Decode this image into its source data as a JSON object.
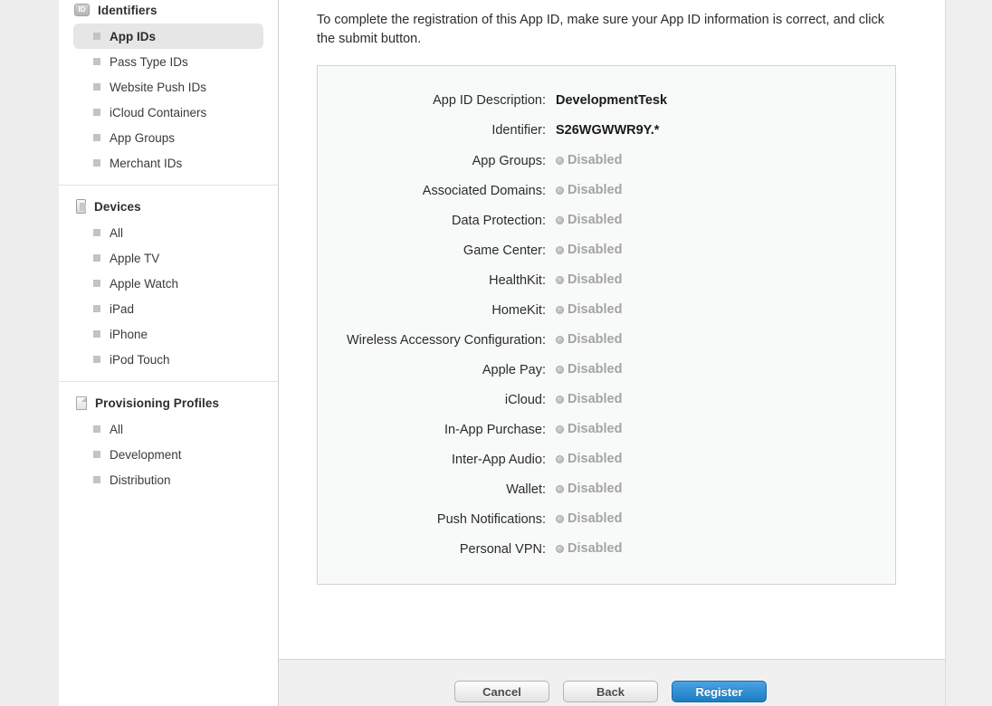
{
  "sidebar": {
    "sections": [
      {
        "title": "Identifiers",
        "icon": "id-badge-icon",
        "icon_text": "ID",
        "items": [
          {
            "label": "App IDs",
            "selected": true
          },
          {
            "label": "Pass Type IDs",
            "selected": false
          },
          {
            "label": "Website Push IDs",
            "selected": false
          },
          {
            "label": "iCloud Containers",
            "selected": false
          },
          {
            "label": "App Groups",
            "selected": false
          },
          {
            "label": "Merchant IDs",
            "selected": false
          }
        ]
      },
      {
        "title": "Devices",
        "icon": "device-phone-icon",
        "items": [
          {
            "label": "All",
            "selected": false
          },
          {
            "label": "Apple TV",
            "selected": false
          },
          {
            "label": "Apple Watch",
            "selected": false
          },
          {
            "label": "iPad",
            "selected": false
          },
          {
            "label": "iPhone",
            "selected": false
          },
          {
            "label": "iPod Touch",
            "selected": false
          }
        ]
      },
      {
        "title": "Provisioning Profiles",
        "icon": "document-icon",
        "items": [
          {
            "label": "All",
            "selected": false
          },
          {
            "label": "Development",
            "selected": false
          },
          {
            "label": "Distribution",
            "selected": false
          }
        ]
      }
    ]
  },
  "main": {
    "intro": "To complete the registration of this App ID, make sure your App ID information is correct, and click the submit button.",
    "details": [
      {
        "label": "App ID Description:",
        "value": "DevelopmentTesk",
        "disabled": false
      },
      {
        "label": "Identifier:",
        "value": "S26WGWWR9Y.*",
        "disabled": false
      },
      {
        "label": "App Groups:",
        "value": "Disabled",
        "disabled": true
      },
      {
        "label": "Associated Domains:",
        "value": "Disabled",
        "disabled": true
      },
      {
        "label": "Data Protection:",
        "value": "Disabled",
        "disabled": true
      },
      {
        "label": "Game Center:",
        "value": "Disabled",
        "disabled": true
      },
      {
        "label": "HealthKit:",
        "value": "Disabled",
        "disabled": true
      },
      {
        "label": "HomeKit:",
        "value": "Disabled",
        "disabled": true
      },
      {
        "label": "Wireless Accessory Configuration:",
        "value": "Disabled",
        "disabled": true
      },
      {
        "label": "Apple Pay:",
        "value": "Disabled",
        "disabled": true
      },
      {
        "label": "iCloud:",
        "value": "Disabled",
        "disabled": true
      },
      {
        "label": "In-App Purchase:",
        "value": "Disabled",
        "disabled": true
      },
      {
        "label": "Inter-App Audio:",
        "value": "Disabled",
        "disabled": true
      },
      {
        "label": "Wallet:",
        "value": "Disabled",
        "disabled": true
      },
      {
        "label": "Push Notifications:",
        "value": "Disabled",
        "disabled": true
      },
      {
        "label": "Personal VPN:",
        "value": "Disabled",
        "disabled": true
      }
    ]
  },
  "footer": {
    "buttons": [
      {
        "label": "Cancel",
        "style": "secondary"
      },
      {
        "label": "Back",
        "style": "secondary"
      },
      {
        "label": "Register",
        "style": "primary"
      }
    ]
  },
  "colors": {
    "primary_button": "#1c7dc2",
    "sidebar_selected": "#e6e6e6",
    "panel_bg": "#f8faf9",
    "disabled_text": "#a3a3a3"
  }
}
